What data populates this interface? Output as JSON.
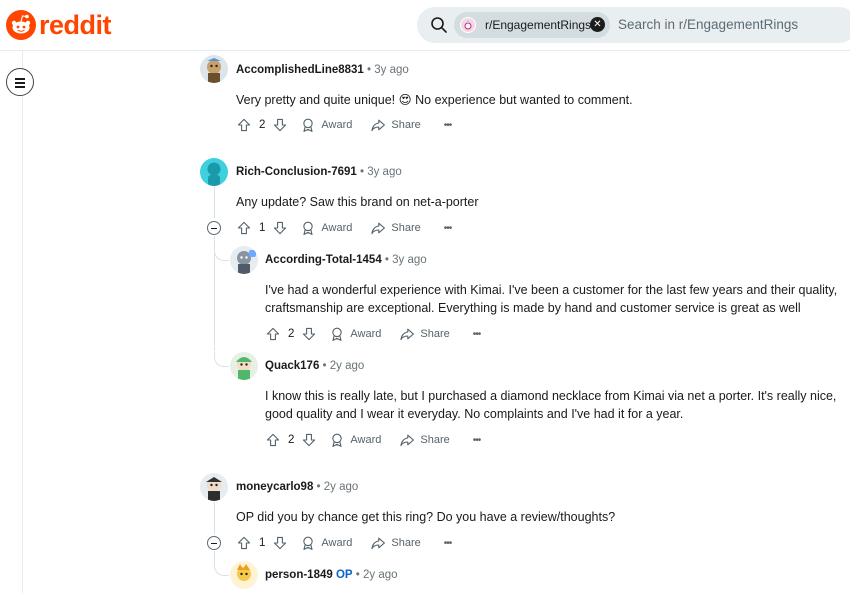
{
  "header": {
    "logo_text": "reddit",
    "search_pill_label": "r/EngagementRings",
    "search_placeholder": "Search in r/EngagementRings"
  },
  "colors": {
    "brand": "#ff4500",
    "op_badge": "#0a64c8"
  },
  "actions": {
    "award": "Award",
    "share": "Share",
    "more": "•••"
  },
  "comments": [
    {
      "author": "AccomplishedLine8831",
      "time": "3y ago",
      "text": "Very pretty and quite unique! 😍 No experience but wanted to comment.",
      "votes": "2"
    },
    {
      "author": "Rich-Conclusion-7691",
      "time": "3y ago",
      "text": "Any update? Saw this brand on net-a-porter",
      "votes": "1"
    },
    {
      "author": "According-Total-1454",
      "time": "3y ago",
      "text": "I've had a wonderful experience with Kimai. I've been a customer for the last few years and their quality, craftsmanship are exceptional. Everything is made by hand and customer service is great as well",
      "votes": "2"
    },
    {
      "author": "Quack176",
      "time": "2y ago",
      "text": "I know this is really late, but I purchased a diamond necklace from Kimai via net a porter. It's really nice, good quality and I wear it everyday. No complaints and I've had it for a year.",
      "votes": "2"
    },
    {
      "author": "moneycarlo98",
      "time": "2y ago",
      "text": "OP did you by chance get this ring? Do you have a review/thoughts?",
      "votes": "1"
    },
    {
      "author": "person-1849",
      "badge": "OP",
      "time": "2y ago"
    }
  ]
}
